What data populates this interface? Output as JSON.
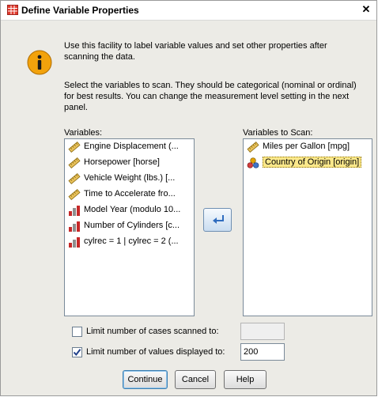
{
  "window": {
    "title": "Define Variable Properties",
    "close_glyph": "✕"
  },
  "intro_text": "Use this facility to label variable values and set other properties after scanning the data.",
  "instructions_text": "Select the variables to scan. They should be categorical (nominal or ordinal) for best results. You can change the measurement level setting in the next panel.",
  "variables": {
    "label": "Variables:",
    "items": [
      {
        "label": "Engine Displacement (...",
        "icon": "ruler-scale-icon"
      },
      {
        "label": "Horsepower [horse]",
        "icon": "ruler-scale-icon"
      },
      {
        "label": "Vehicle Weight (lbs.) [...",
        "icon": "ruler-scale-icon"
      },
      {
        "label": "Time to Accelerate fro...",
        "icon": "ruler-scale-icon"
      },
      {
        "label": "Model Year (modulo 10...",
        "icon": "bar-ordinal-icon"
      },
      {
        "label": "Number of Cylinders [c...",
        "icon": "bar-ordinal-icon"
      },
      {
        "label": "cylrec = 1 | cylrec = 2 (...",
        "icon": "bar-ordinal-icon"
      }
    ]
  },
  "scan": {
    "label": "Variables to Scan:",
    "items": [
      {
        "label": "Miles per Gallon [mpg]",
        "icon": "ruler-scale-icon"
      },
      {
        "label": "Country of Origin [origin]",
        "icon": "nominal-circles-icon",
        "selected": true
      }
    ]
  },
  "limit_cases": {
    "label": "Limit number of cases scanned to:",
    "checked": false,
    "value": ""
  },
  "limit_values": {
    "label": "Limit number of values displayed to:",
    "checked": true,
    "value": "200"
  },
  "buttons": {
    "continue": "Continue",
    "cancel": "Cancel",
    "help": "Help"
  },
  "colors": {
    "selection": "#fbe88b",
    "title_icon": "#e23b2e",
    "info_icon": "#f2a20c"
  }
}
